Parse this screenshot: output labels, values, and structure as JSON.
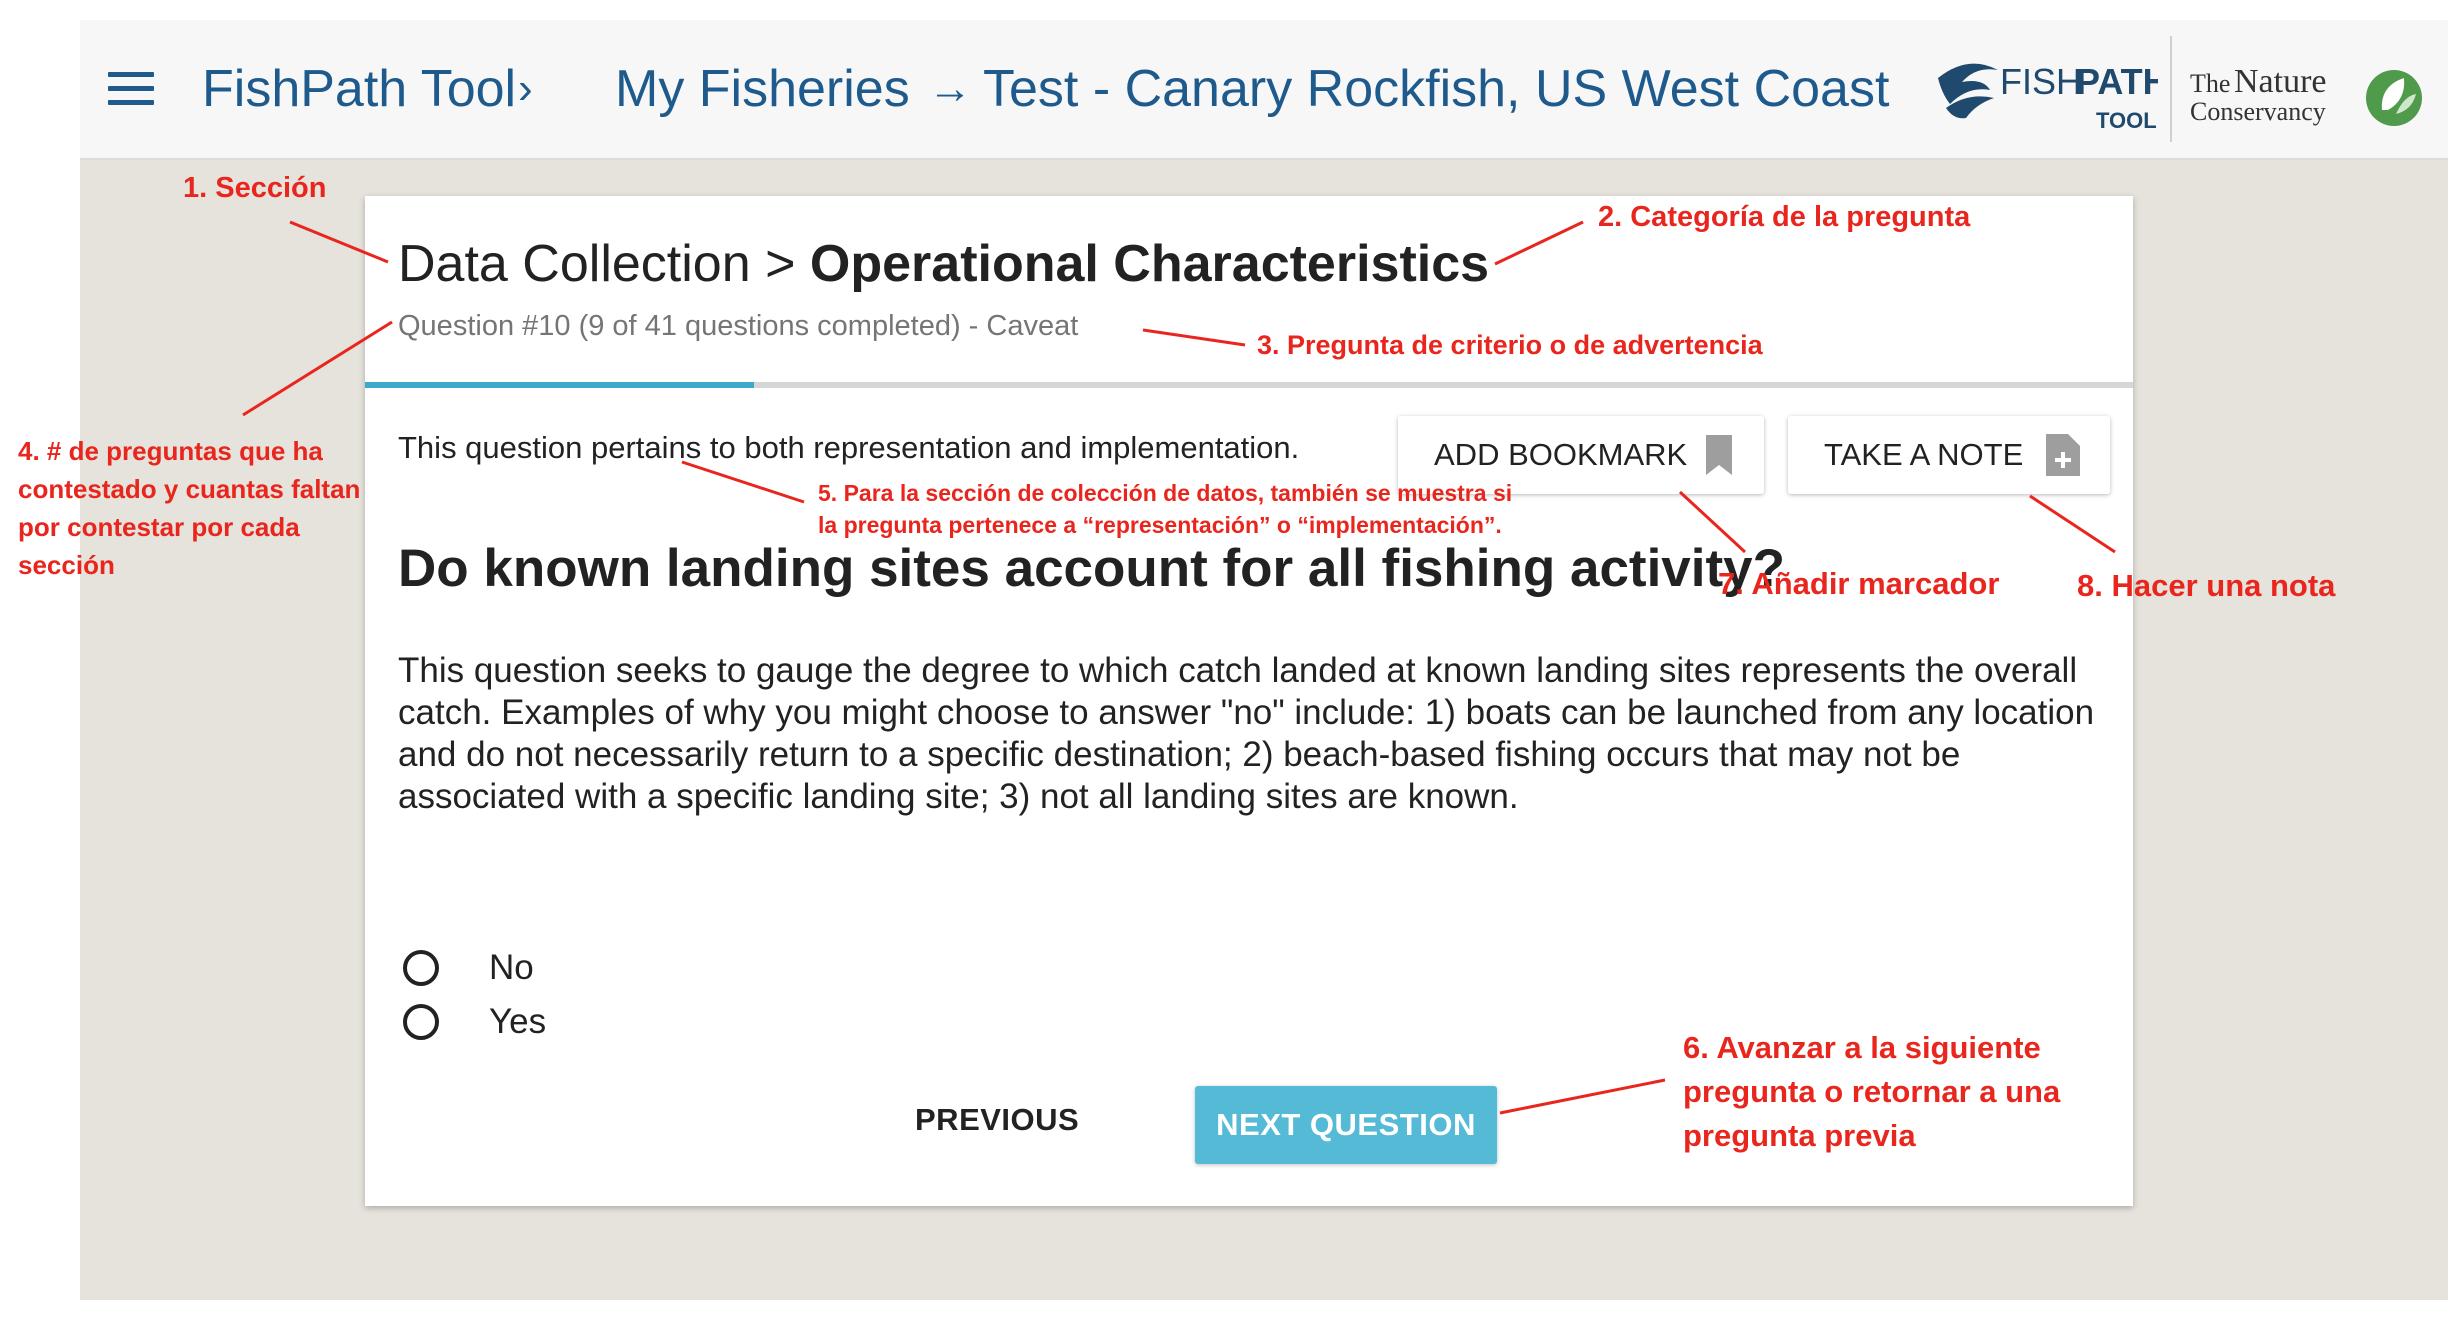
{
  "header": {
    "breadcrumb": [
      "FishPath Tool",
      "My Fisheries",
      "Test - Canary Rockfish, US West Coast"
    ],
    "separators": [
      "›",
      "→"
    ],
    "fishpath_logo": {
      "word1": "FISH",
      "word2": "PATH",
      "sub": "TOOL"
    },
    "tnc_logo": {
      "line1a": "The",
      "line1b": "Nature",
      "line2": "Conservancy"
    }
  },
  "card": {
    "section": "Data Collection",
    "separator": ">",
    "category": "Operational Characteristics",
    "meta": "Question #10 (9 of 41 questions completed) - Caveat",
    "progress": 0.22,
    "pertains": "This question pertains to both representation and implementation.",
    "bookmark_label": "ADD BOOKMARK",
    "note_label": "TAKE A NOTE",
    "question": "Do known landing sites account for all fishing activity?",
    "description": "This question seeks to gauge the degree to which catch landed at known landing sites represents the overall catch. Examples of why you might choose to answer \"no\" include: 1) boats can be launched from any location and do not necessarily return to a specific destination; 2) beach-based fishing occurs that may not be associated with a specific landing site; 3) not all landing sites are known.",
    "options": [
      "No",
      "Yes"
    ],
    "previous_label": "PREVIOUS",
    "next_label": "NEXT QUESTION"
  },
  "annotations": {
    "a1": "1. Sección",
    "a2": "2. Categoría de la pregunta",
    "a3": "3. Pregunta de criterio o de advertencia",
    "a4": [
      "4. # de preguntas que ha",
      "contestado y cuantas faltan",
      "por contestar por cada",
      "sección"
    ],
    "a5": [
      "5. Para la sección de colección de datos, también se muestra si",
      "la pregunta pertenece a “representación” o “implementación”."
    ],
    "a6": [
      "6. Avanzar a la siguiente",
      "pregunta o retornar a una",
      "pregunta previa"
    ],
    "a7": "7. Añadir marcador",
    "a8": "8. Hacer una nota"
  },
  "colors": {
    "brand_blue": "#1f5a8c",
    "accent": "#55bad6",
    "annotation_red": "#e8261d",
    "background": "#e6e2dc"
  },
  "icons": [
    "menu-icon",
    "bookmark-icon",
    "note-add-icon",
    "fish-icon",
    "leaf-icon"
  ]
}
